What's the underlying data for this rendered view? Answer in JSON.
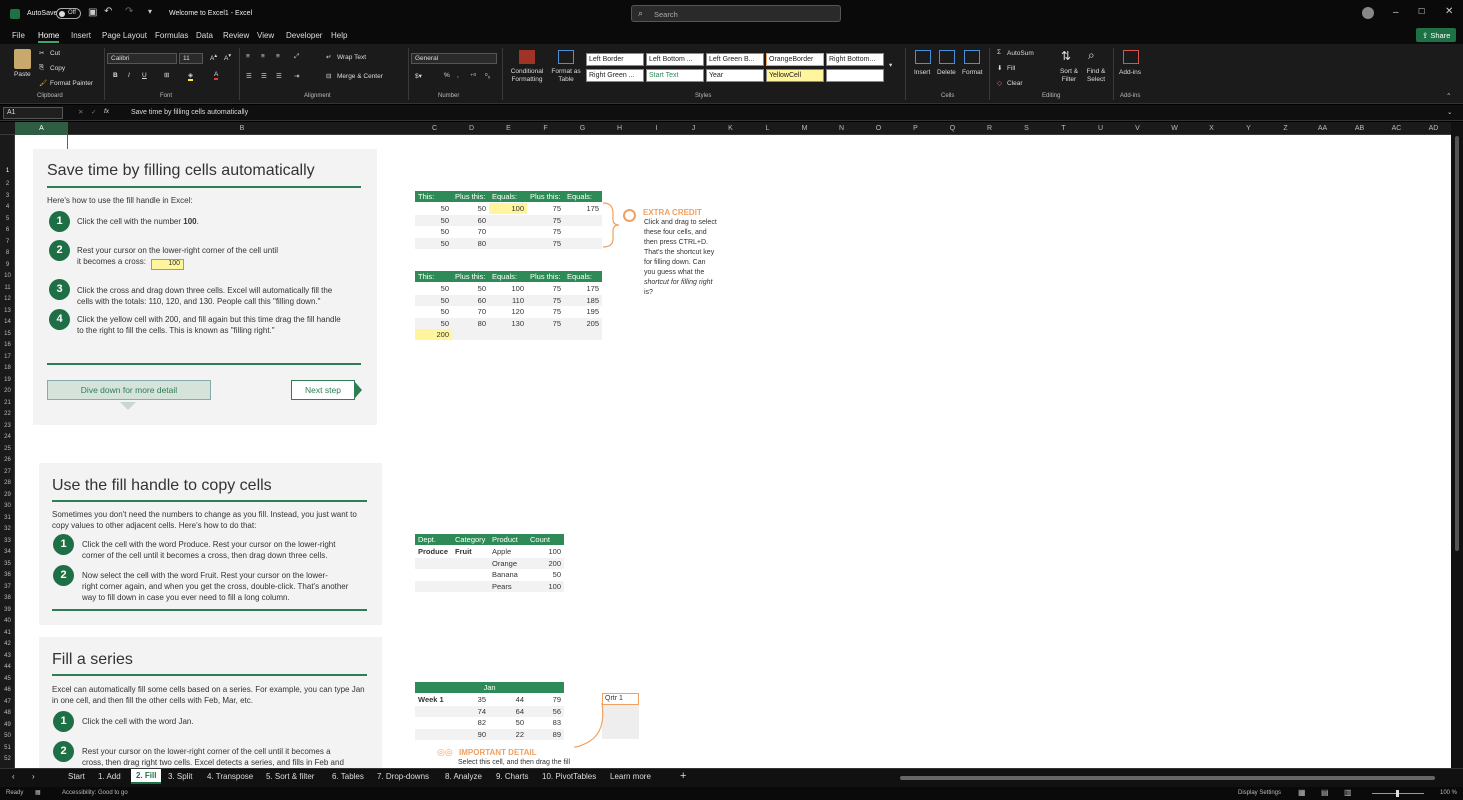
{
  "titlebar": {
    "autosave": "AutoSave",
    "autosave_state": "Off",
    "title": "Welcome to Excel1 - Excel",
    "search_placeholder": "Search"
  },
  "menu": {
    "items": [
      "File",
      "Home",
      "Insert",
      "Page Layout",
      "Formulas",
      "Data",
      "Review",
      "View",
      "Developer",
      "Help"
    ],
    "share": "Share"
  },
  "ribbon": {
    "clipboard": {
      "paste": "Paste",
      "cut": "Cut",
      "copy": "Copy",
      "format_painter": "Format Painter",
      "label": "Clipboard"
    },
    "font": {
      "name": "Calibri",
      "size": "11",
      "label": "Font"
    },
    "alignment": {
      "wrap": "Wrap Text",
      "merge": "Merge & Center",
      "label": "Alignment"
    },
    "number": {
      "format": "General",
      "label": "Number"
    },
    "styles": {
      "cond": "Conditional Formatting",
      "fmt_table": "Format as Table",
      "cells": [
        "Left Border",
        "Left Bottom ...",
        "Left Green B...",
        "OrangeBorder",
        "Right Bottom...",
        "Right Green ...",
        "Start Text",
        "Year",
        "YellowCell",
        ""
      ],
      "label": "Styles"
    },
    "cells": {
      "insert": "Insert",
      "delete": "Delete",
      "format": "Format",
      "label": "Cells"
    },
    "editing": {
      "autosum": "AutoSum",
      "fill": "Fill",
      "clear": "Clear",
      "sort": "Sort & Filter",
      "find": "Find & Select",
      "label": "Editing"
    },
    "addins": {
      "addins": "Add-ins",
      "label": "Add-ins"
    }
  },
  "formula": {
    "namebox": "A1",
    "fx": "fx",
    "content": "Save time by filling cells automatically"
  },
  "columns": [
    "A",
    "B",
    "C",
    "D",
    "E",
    "F",
    "G",
    "H",
    "I",
    "J",
    "K",
    "L",
    "M",
    "N",
    "O",
    "P",
    "Q",
    "R",
    "S",
    "T",
    "U",
    "V",
    "W",
    "X",
    "Y",
    "Z",
    "AA",
    "AB",
    "AC",
    "AD"
  ],
  "rows": [
    "1",
    "2",
    "3",
    "4",
    "5",
    "6",
    "7",
    "8",
    "9",
    "10",
    "11",
    "12",
    "13",
    "14",
    "15",
    "16",
    "17",
    "18",
    "19",
    "20",
    "21",
    "22",
    "23",
    "24",
    "25",
    "26",
    "27",
    "28",
    "29",
    "30",
    "31",
    "32",
    "33",
    "34",
    "35",
    "36",
    "37",
    "38",
    "39",
    "40",
    "41",
    "42",
    "43",
    "44",
    "45",
    "46",
    "47",
    "48",
    "49",
    "50",
    "51",
    "52"
  ],
  "card1": {
    "title": "Save time by filling cells automatically",
    "intro": "Here's how to use the fill handle in Excel:",
    "s1": "Click the cell with the number ",
    "s1b": "100",
    "s2a": "Rest your cursor on the lower-right corner of the cell until",
    "s2b": "it becomes a cross:",
    "s2cell": "100",
    "s3a": "Click the cross and drag down three cells. Excel will automatically fill the",
    "s3b": "cells with the totals: 110, 120, and 130. People call this \"filling down.\"",
    "s4a": "Click the yellow cell with 200, and fill again but this time drag the fill handle",
    "s4b": "to the right to fill the cells. This is known as \"filling right.\"",
    "dive": "Dive down for more detail",
    "next": "Next step",
    "nums": [
      "1",
      "2",
      "3",
      "4"
    ]
  },
  "table1": {
    "headers": [
      "This:",
      "Plus this:",
      "Equals:",
      "Plus this:",
      "Equals:"
    ],
    "rows": [
      [
        "50",
        "50",
        "100",
        "75",
        "175"
      ],
      [
        "50",
        "60",
        "",
        "75",
        ""
      ],
      [
        "50",
        "70",
        "",
        "75",
        ""
      ],
      [
        "50",
        "80",
        "",
        "75",
        ""
      ]
    ]
  },
  "table2": {
    "headers": [
      "This:",
      "Plus this:",
      "Equals:",
      "Plus this:",
      "Equals:"
    ],
    "rows": [
      [
        "50",
        "50",
        "100",
        "75",
        "175"
      ],
      [
        "50",
        "60",
        "110",
        "75",
        "185"
      ],
      [
        "50",
        "70",
        "120",
        "75",
        "195"
      ],
      [
        "50",
        "80",
        "130",
        "75",
        "205"
      ]
    ],
    "extra": "200"
  },
  "extra_credit": {
    "title": "EXTRA CREDIT",
    "lines": [
      "Click and drag to select",
      "these four cells, and",
      "then press CTRL+D.",
      "That's the shortcut key",
      "for filling down. Can",
      "you guess what the",
      "shortcut for filling right",
      "is?"
    ]
  },
  "card2": {
    "title": "Use the fill handle to copy cells",
    "intro1": "Sometimes you don't need the numbers to change as you fill. Instead, you just want to",
    "intro2": "copy values to other adjacent cells. Here's how to do that:",
    "s1a": "Click the cell with the word Produce. Rest your cursor on the lower-right",
    "s1b": "corner of the cell until it becomes a cross, then drag down three cells.",
    "s2a": "Now select the cell with the word Fruit. Rest your cursor on the lower-",
    "s2b": "right corner again, and when you get the cross, double-click. That's another",
    "s2c": "way to fill down in case you ever need to fill a long column.",
    "nums": [
      "1",
      "2"
    ]
  },
  "table3": {
    "headers": [
      "Dept.",
      "Category",
      "Product",
      "Count"
    ],
    "rows": [
      [
        "Produce",
        "Fruit",
        "Apple",
        "100"
      ],
      [
        "",
        "",
        "Orange",
        "200"
      ],
      [
        "",
        "",
        "Banana",
        "50"
      ],
      [
        "",
        "",
        "Pears",
        "100"
      ]
    ]
  },
  "card3": {
    "title": "Fill a series",
    "intro1": "Excel can automatically fill some cells based on a series. For example, you can type Jan",
    "intro2": "in one cell, and then fill the other cells with Feb, Mar, etc.",
    "s1": "Click the cell with the word Jan.",
    "s2a": "Rest your cursor on the lower-right corner of the cell until it becomes a",
    "s2b": "cross, then drag right two cells. Excel detects a series, and fills in Feb and",
    "nums": [
      "1",
      "2"
    ]
  },
  "table4": {
    "header": "Jan",
    "rows": [
      [
        "Week 1",
        "35",
        "44",
        "79"
      ],
      [
        "",
        "74",
        "64",
        "56"
      ],
      [
        "",
        "82",
        "50",
        "83"
      ],
      [
        "",
        "90",
        "22",
        "89"
      ]
    ],
    "qtr": "Qrtr 1"
  },
  "important": {
    "title": "IMPORTANT DETAIL",
    "line": "Select this cell, and then drag the fill"
  },
  "tabs": [
    "Start",
    "1. Add",
    "2. Fill",
    "3. Split",
    "4. Transpose",
    "5. Sort & filter",
    "6. Tables",
    "7. Drop-downs",
    "8. Analyze",
    "9. Charts",
    "10. PivotTables",
    "Learn more"
  ],
  "status": {
    "ready": "Ready",
    "accessibility": "Accessibility: Good to go",
    "display": "Display Settings",
    "zoom": "100 %"
  },
  "colors": {
    "green": "#2e8b57",
    "dark_green": "#1e6f46",
    "yellow": "#fff59d",
    "orange": "#f0a060"
  }
}
